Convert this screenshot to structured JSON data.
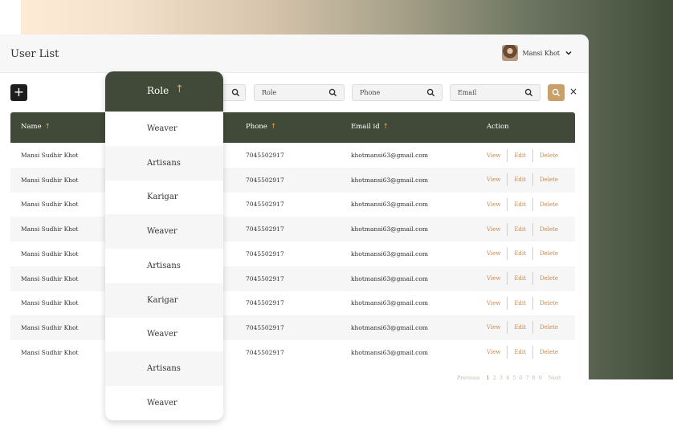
{
  "colors": {
    "accent_dark": "#414a38",
    "accent_gold": "#c9a06a",
    "action_text": "#c48a52"
  },
  "header": {
    "title": "User List",
    "user_name": "Mansi Khot",
    "avatar_icon": "avatar-photo",
    "menu_icon": "chevron-down-icon"
  },
  "toolbar": {
    "add_label": "+",
    "filters": [
      {
        "placeholder": "Role",
        "icon": "search-icon"
      },
      {
        "placeholder": "Phone",
        "icon": "search-icon"
      },
      {
        "placeholder": "Email",
        "icon": "search-icon"
      }
    ],
    "search_icon": "search-icon",
    "clear_label": "×"
  },
  "table": {
    "columns": [
      {
        "label": "Name",
        "sort": "↑"
      },
      {
        "label": "Phone",
        "sort": "↑"
      },
      {
        "label": "Email id",
        "sort": "↑"
      },
      {
        "label": "Action"
      }
    ],
    "rows": [
      {
        "name": "Mansi Sudhir Khot",
        "phone": "7045502917",
        "email": "khotmansi63@gmail.com"
      },
      {
        "name": "Mansi Sudhir Khot",
        "phone": "7045502917",
        "email": "khotmansi63@gmail.com"
      },
      {
        "name": "Mansi Sudhir Khot",
        "phone": "7045502917",
        "email": "khotmansi63@gmail.com"
      },
      {
        "name": "Mansi Sudhir Khot",
        "phone": "7045502917",
        "email": "khotmansi63@gmail.com"
      },
      {
        "name": "Mansi Sudhir Khot",
        "phone": "7045502917",
        "email": "khotmansi63@gmail.com"
      },
      {
        "name": "Mansi Sudhir Khot",
        "phone": "7045502917",
        "email": "khotmansi63@gmail.com"
      },
      {
        "name": "Mansi Sudhir Khot",
        "phone": "7045502917",
        "email": "khotmansi63@gmail.com"
      },
      {
        "name": "Mansi Sudhir Khot",
        "phone": "7045502917",
        "email": "khotmansi63@gmail.com"
      },
      {
        "name": "Mansi Sudhir Khot",
        "phone": "7045502917",
        "email": "khotmansi63@gmail.com"
      }
    ],
    "actions": {
      "view": "View",
      "edit": "Edit",
      "delete": "Delete"
    }
  },
  "pagination": {
    "previous": "Previous",
    "pages": [
      "1",
      "2",
      "3",
      "4",
      "5",
      "6",
      "7",
      "8",
      "9"
    ],
    "current": "1",
    "next": "Next"
  },
  "role_dropdown": {
    "label": "Role",
    "sort": "↑",
    "options": [
      "Weaver",
      "Artisans",
      "Karigar",
      "Weaver",
      "Artisans",
      "Karigar",
      "Weaver",
      "Artisans",
      "Weaver"
    ]
  }
}
